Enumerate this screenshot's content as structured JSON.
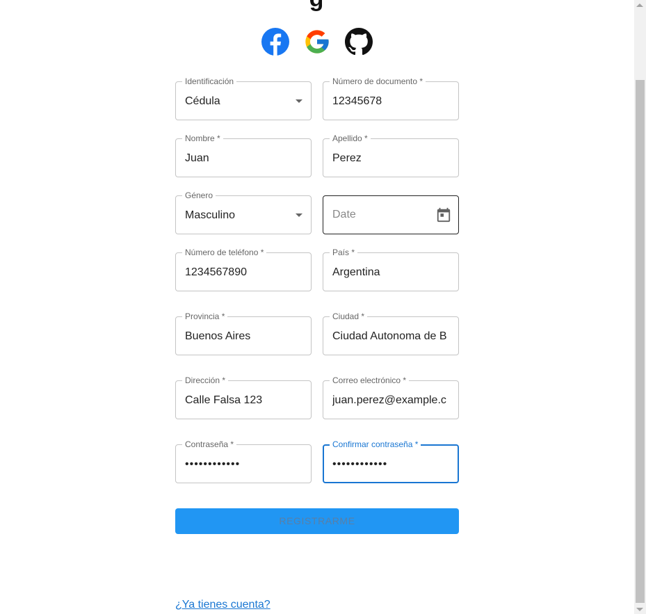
{
  "page": {
    "title_fragment": "g"
  },
  "social": {
    "icons": [
      "facebook-icon",
      "google-icon",
      "github-icon"
    ],
    "facebook_color": "#1877F2"
  },
  "form": {
    "identificacion": {
      "label": "Identificación",
      "value": "Cédula"
    },
    "numero_documento": {
      "label": "Número de documento *",
      "value": "12345678"
    },
    "nombre": {
      "label": "Nombre *",
      "value": "Juan"
    },
    "apellido": {
      "label": "Apellido *",
      "value": "Perez"
    },
    "genero": {
      "label": "Género",
      "value": "Masculino"
    },
    "fecha": {
      "placeholder": "Date"
    },
    "telefono": {
      "label": "Número de teléfono *",
      "value": "1234567890"
    },
    "pais": {
      "label": "País *",
      "value": "Argentina"
    },
    "provincia": {
      "label": "Provincia *",
      "value": "Buenos Aires"
    },
    "ciudad": {
      "label": "Ciudad *",
      "value": "Ciudad Autonoma de B"
    },
    "direccion": {
      "label": "Dirección *",
      "value": "Calle Falsa 123"
    },
    "correo": {
      "label": "Correo electrónico *",
      "value": "juan.perez@example.c"
    },
    "contrasena": {
      "label": "Contraseña *",
      "value": "••••••••••••"
    },
    "confirmar": {
      "label": "Confirmar contraseña *",
      "value": "••••••••••••"
    },
    "submit_label": "REGISTRARME"
  },
  "footer": {
    "login_link": "¿Ya tienes cuenta?"
  },
  "colors": {
    "accent": "#1976d2",
    "button": "#2196f3"
  }
}
